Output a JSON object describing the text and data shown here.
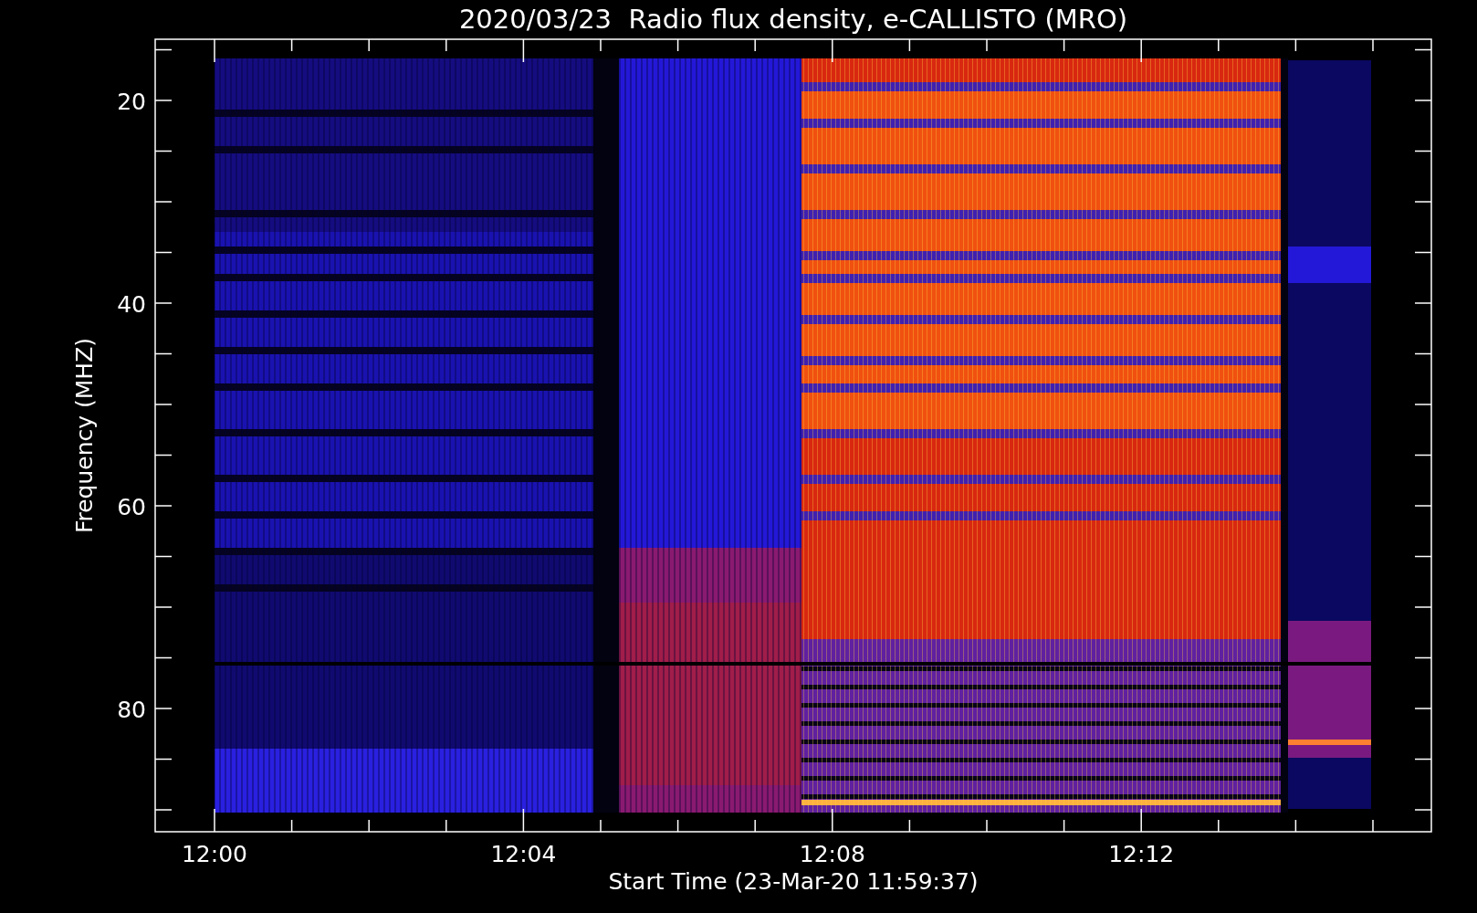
{
  "title": "2020/03/23  Radio flux density, e-CALLISTO (MRO)",
  "y_axis": {
    "label": "Frequency (MHZ)",
    "ticks": [
      "20",
      "40",
      "60",
      "80"
    ]
  },
  "x_axis": {
    "label": "Start Time (23-Mar-20 11:59:37)",
    "ticks": [
      "12:00",
      "12:04",
      "12:08",
      "12:12"
    ]
  }
}
